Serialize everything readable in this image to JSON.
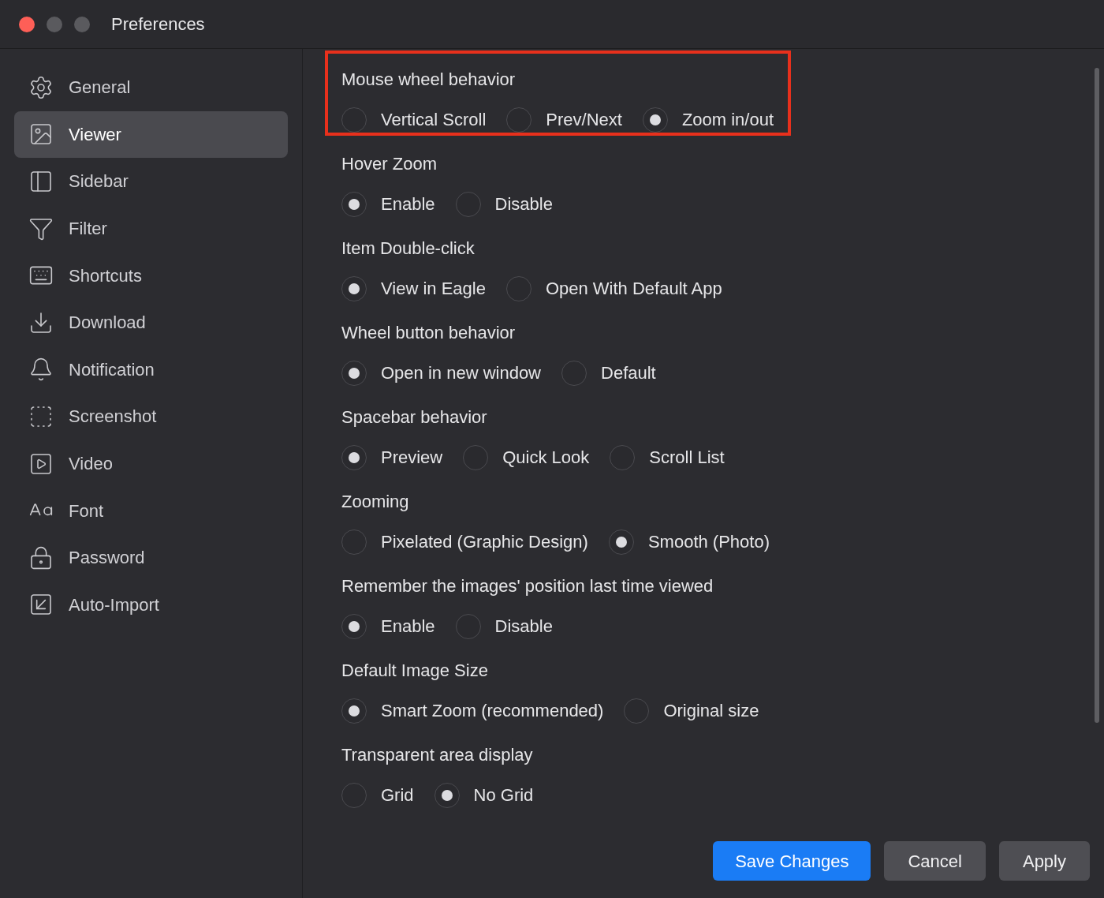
{
  "window": {
    "title": "Preferences"
  },
  "sidebar": {
    "items": [
      {
        "label": "General",
        "selected": false
      },
      {
        "label": "Viewer",
        "selected": true
      },
      {
        "label": "Sidebar",
        "selected": false
      },
      {
        "label": "Filter",
        "selected": false
      },
      {
        "label": "Shortcuts",
        "selected": false
      },
      {
        "label": "Download",
        "selected": false
      },
      {
        "label": "Notification",
        "selected": false
      },
      {
        "label": "Screenshot",
        "selected": false
      },
      {
        "label": "Video",
        "selected": false
      },
      {
        "label": "Font",
        "selected": false
      },
      {
        "label": "Password",
        "selected": false
      },
      {
        "label": "Auto-Import",
        "selected": false
      }
    ]
  },
  "settings": [
    {
      "title": "Mouse wheel behavior",
      "highlighted": true,
      "options": [
        {
          "label": "Vertical Scroll",
          "selected": false
        },
        {
          "label": "Prev/Next",
          "selected": false
        },
        {
          "label": "Zoom in/out",
          "selected": true
        }
      ]
    },
    {
      "title": "Hover Zoom",
      "highlighted": false,
      "options": [
        {
          "label": "Enable",
          "selected": true
        },
        {
          "label": "Disable",
          "selected": false
        }
      ]
    },
    {
      "title": "Item Double-click",
      "highlighted": false,
      "options": [
        {
          "label": "View in Eagle",
          "selected": true
        },
        {
          "label": "Open With Default App",
          "selected": false
        }
      ]
    },
    {
      "title": "Wheel button behavior",
      "highlighted": false,
      "options": [
        {
          "label": "Open in new window",
          "selected": true
        },
        {
          "label": "Default",
          "selected": false
        }
      ]
    },
    {
      "title": "Spacebar behavior",
      "highlighted": false,
      "options": [
        {
          "label": "Preview",
          "selected": true
        },
        {
          "label": "Quick Look",
          "selected": false
        },
        {
          "label": "Scroll List",
          "selected": false
        }
      ]
    },
    {
      "title": "Zooming",
      "highlighted": false,
      "options": [
        {
          "label": "Pixelated (Graphic Design)",
          "selected": false
        },
        {
          "label": "Smooth (Photo)",
          "selected": true
        }
      ]
    },
    {
      "title": "Remember the images' position last time viewed",
      "highlighted": false,
      "options": [
        {
          "label": "Enable",
          "selected": true
        },
        {
          "label": "Disable",
          "selected": false
        }
      ]
    },
    {
      "title": "Default Image Size",
      "highlighted": false,
      "options": [
        {
          "label": "Smart Zoom (recommended)",
          "selected": true
        },
        {
          "label": "Original size",
          "selected": false
        }
      ]
    },
    {
      "title": "Transparent area display",
      "highlighted": false,
      "options": [
        {
          "label": "Grid",
          "selected": false
        },
        {
          "label": "No Grid",
          "selected": true
        }
      ]
    }
  ],
  "buttons": [
    {
      "label": "Save Changes",
      "kind": "primary"
    },
    {
      "label": "Cancel",
      "kind": "secondary"
    },
    {
      "label": "Apply",
      "kind": "secondary"
    }
  ]
}
